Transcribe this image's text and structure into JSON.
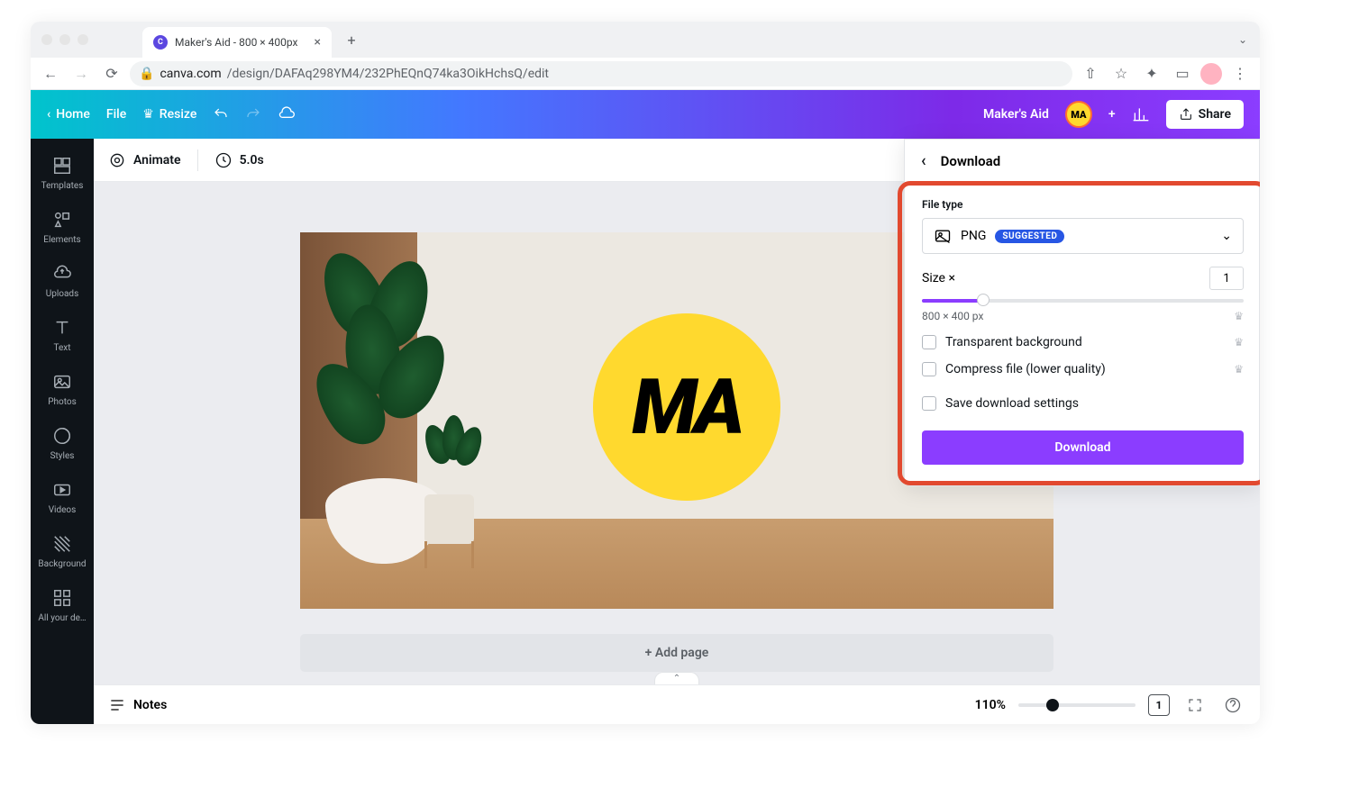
{
  "browser": {
    "tab_title": "Maker's Aid - 800 × 400px",
    "url_secure": true,
    "url_domain": "canva.com",
    "url_path": "/design/DAFAq298YM4/232PhEQnQ74ka3OikHchsQ/edit"
  },
  "header": {
    "home": "Home",
    "file": "File",
    "resize": "Resize",
    "doc_title": "Maker's Aid",
    "avatar_text": "MA",
    "share": "Share"
  },
  "sidebar": {
    "items": [
      "Templates",
      "Elements",
      "Uploads",
      "Text",
      "Photos",
      "Styles",
      "Videos",
      "Background",
      "All your de…"
    ]
  },
  "toolbar": {
    "animate": "Animate",
    "duration": "5.0s"
  },
  "canvas": {
    "logo_text": "MA",
    "add_page": "+ Add page"
  },
  "footer": {
    "notes": "Notes",
    "zoom": "110%",
    "page_count": "1"
  },
  "download": {
    "title": "Download",
    "filetype_label": "File type",
    "filetype_value": "PNG",
    "filetype_badge": "SUGGESTED",
    "size_label": "Size ×",
    "size_value": "1",
    "dimensions": "800 × 400 px",
    "opt_transparent": "Transparent background",
    "opt_compress": "Compress file (lower quality)",
    "opt_save": "Save download settings",
    "button": "Download"
  }
}
